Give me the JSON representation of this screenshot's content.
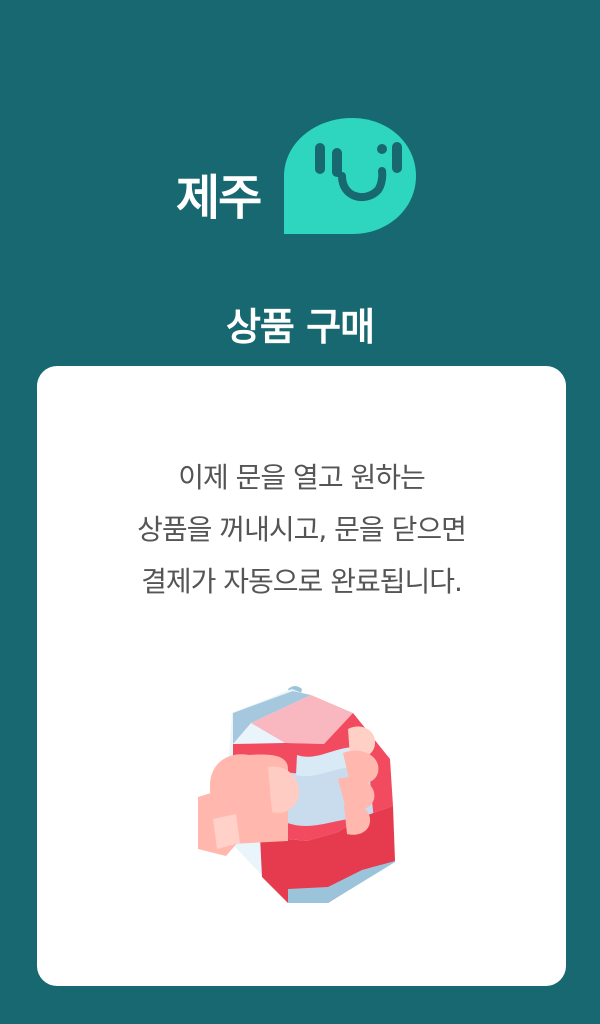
{
  "logo": {
    "text": "제주",
    "icon": "speech-bubble-face-icon",
    "colors": {
      "bubble": "#2fd6bf",
      "eyes": "#176870"
    }
  },
  "page": {
    "title": "상품 구매"
  },
  "card": {
    "instruction_lines": [
      "이제 문을 열고 원하는",
      "상품을 꺼내시고, 문을 닫으면",
      "결제가 자동으로 완료됩니다."
    ],
    "illustration": "hand-holding-can-icon"
  },
  "colors": {
    "background": "#176870",
    "card": "#ffffff",
    "text": "#555555",
    "can_red": "#f24b5f",
    "can_blue": "#a8c9df",
    "skin": "#ffb9b0"
  }
}
